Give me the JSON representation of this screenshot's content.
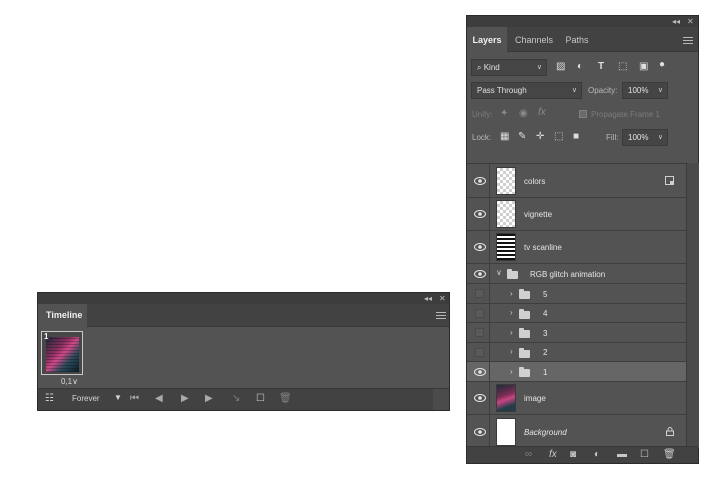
{
  "timeline": {
    "tab": "Timeline",
    "frame": {
      "number": "1",
      "delay": "0,1"
    },
    "loop": "Forever"
  },
  "layers": {
    "tabs": [
      "Layers",
      "Channels",
      "Paths"
    ],
    "filter_kind": "Kind",
    "blend_mode": "Pass Through",
    "opacity_label": "Opacity:",
    "opacity_value": "100%",
    "unify_label": "Unify:",
    "propagate_label": "Propagate Frame 1",
    "lock_label": "Lock:",
    "fill_label": "Fill:",
    "fill_value": "100%",
    "items": [
      {
        "name": "colors",
        "visible": true
      },
      {
        "name": "vignette",
        "visible": true
      },
      {
        "name": "tv scanline",
        "visible": true
      },
      {
        "name": "RGB glitch animation",
        "visible": true
      },
      {
        "name": "5",
        "visible": false
      },
      {
        "name": "4",
        "visible": false
      },
      {
        "name": "3",
        "visible": false
      },
      {
        "name": "2",
        "visible": false
      },
      {
        "name": "1",
        "visible": true,
        "selected": true
      },
      {
        "name": "image",
        "visible": true
      },
      {
        "name": "Background",
        "visible": true,
        "locked": true
      }
    ]
  }
}
